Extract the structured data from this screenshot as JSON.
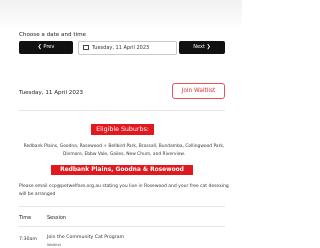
{
  "booking": {
    "choose_label": "Choose a date and time",
    "prev_label": "❮ Prev",
    "next_label": "Next ❯",
    "date_input_value": "Tuesday, 11 April 2023"
  },
  "day": {
    "selected_date": "Tuesday, 11 April 2023",
    "waitlist_label": "Join Waitlist"
  },
  "notice": {
    "eligible_heading": "Eligible Suburbs:",
    "suburbs_text": "Redbank Plains, Goodna, Rosewood + Bellbird Park, Brassall, Bundamba, Collingwood Park, Dinmore, Ebbw Vale, Gailes, New Chum, and Riverview.",
    "free_heading": "Redbank Plains, Goodna & Rosewood FREE:",
    "email_text": "Please email ccp@petwelfare.org.au stating you live in Rosewood and your free cat desexing will be arranged"
  },
  "table": {
    "headers": [
      "Time",
      "Session"
    ],
    "rows": [
      {
        "time": "7:30am",
        "session": "Join the Community Cat Program",
        "sub": "Waitlist"
      }
    ]
  },
  "colors": {
    "accent_red": "#e1191f",
    "button_dark": "#111111"
  }
}
